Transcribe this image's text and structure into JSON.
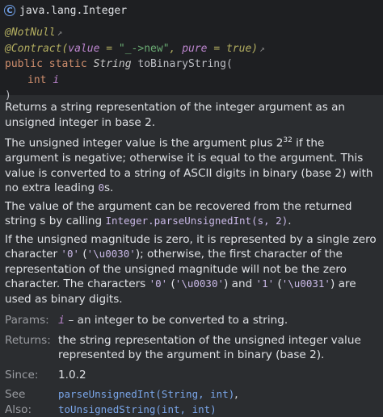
{
  "header": {
    "class_icon_letter": "C",
    "class_name": "java.lang.Integer"
  },
  "signature": {
    "annotation1": "@NotNull",
    "annotation2_name": "@Contract",
    "annotation2_open": "(",
    "contract_value_key": "value",
    "contract_eq1": " = ",
    "contract_value": "\"_->new\"",
    "contract_comma": ", ",
    "contract_pure_key": "pure",
    "contract_eq2": " = ",
    "contract_pure_value": "true",
    "annotation2_close": ")",
    "external_arrow": "↗",
    "modifiers": "public static ",
    "return_type": "String",
    "method_name": " toBinaryString(",
    "param_type": "int ",
    "param_name": "i",
    "close_paren": ")"
  },
  "description": {
    "p1": "Returns a string representation of the integer argument as an unsigned integer in base 2.",
    "p2_a": "The unsigned integer value is the argument plus 2",
    "p2_sup": "32",
    "p2_b": " if the argument is negative; otherwise it is equal to the argument. This value is converted to a string of ASCII digits in binary (base 2) with no extra leading ",
    "p2_code": "0",
    "p2_c": "s.",
    "p3_a": "The value of the argument can be recovered from the returned string ",
    "p3_s": "s",
    "p3_b": " by calling ",
    "p3_code": "Integer.parseUnsignedInt(s, 2)",
    "p3_c": ".",
    "p4_a": "If the unsigned magnitude is zero, it is represented by a single zero character ",
    "p4_code1": "'0'",
    "p4_b": " (",
    "p4_code2": "'\\u0030'",
    "p4_c": "); otherwise, the first character of the representation of the unsigned magnitude will not be the zero character. The characters ",
    "p4_code3": "'0'",
    "p4_d": " (",
    "p4_code4": "'\\u0030'",
    "p4_e": ") and ",
    "p4_code5": "'1'",
    "p4_f": " (",
    "p4_code6": "'\\u0031'",
    "p4_g": ") are used as binary digits."
  },
  "tags": {
    "params_label": "Params:",
    "params_name": "i",
    "params_text": " – an integer to be converted to a string.",
    "returns_label": "Returns:",
    "returns_text": "the string representation of the unsigned integer value represented by the argument in binary (base 2).",
    "since_label": "Since:",
    "since_value": "1.0.2",
    "seealso_label": "See Also:",
    "seealso_1": "parseUnsignedInt(String, int)",
    "seealso_sep": ",",
    "seealso_2": "toUnsignedString(int, int)"
  },
  "colors": {
    "background": "#2b2d30",
    "header_background": "#1e1f22",
    "annotation": "#b3ae60",
    "keyword": "#cf8e6d",
    "string": "#6aab73",
    "parameter": "#bd86cf",
    "link": "#7aa6ea"
  },
  "icons": {
    "class_icon": "class-icon",
    "external_link": "external-link-icon"
  }
}
